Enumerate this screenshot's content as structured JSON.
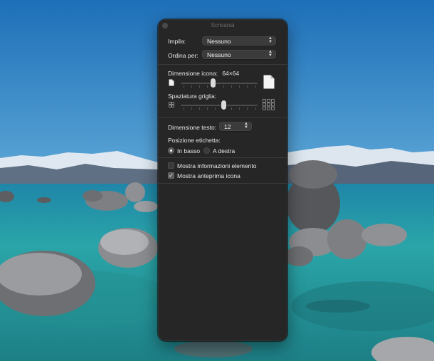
{
  "window": {
    "title": "Scrivania"
  },
  "stack_by": {
    "label": "Impila:",
    "value": "Nessuno"
  },
  "sort_by": {
    "label": "Ordina per:",
    "value": "Nessuno"
  },
  "icon_size": {
    "label": "Dimensione icona:",
    "value_text": "64×64",
    "slider_fraction": 0.42
  },
  "grid_spacing": {
    "label": "Spaziatura griglia:",
    "slider_fraction": 0.56
  },
  "text_size": {
    "label": "Dimensione testo:",
    "value": "12"
  },
  "label_position": {
    "label": "Posizione etichetta:",
    "options": [
      {
        "label": "In basso",
        "selected": true
      },
      {
        "label": "A destra",
        "selected": false
      }
    ]
  },
  "options": [
    {
      "label": "Mostra informazioni elemento",
      "checked": false
    },
    {
      "label": "Mostra anteprima icona",
      "checked": true
    }
  ],
  "icons": {
    "stepper": "up-down-chevron-icon",
    "small_doc": "small-document-icon",
    "large_doc": "large-document-icon",
    "small_grid": "small-grid-icon",
    "large_grid": "large-grid-icon",
    "check": "checkmark-icon"
  },
  "colors": {
    "panel_bg": "#262626",
    "control_bg": "#3b3b3b",
    "separator": "#3a3a3a"
  }
}
